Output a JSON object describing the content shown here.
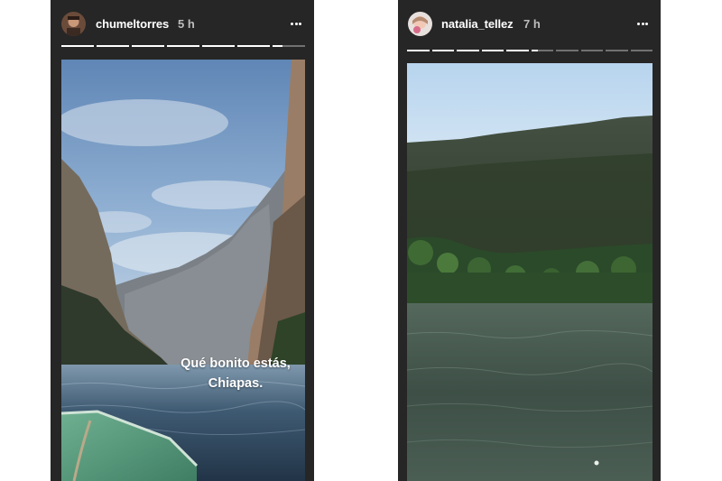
{
  "stories": [
    {
      "username": "chumeltorres",
      "time": "5 h",
      "more_icon": "more-horizontal-icon",
      "progress": {
        "segments": 7,
        "completed": 6,
        "current_fill": 0.3
      },
      "caption_lines": [
        "Qué bonito estás,",
        "Chiapas."
      ]
    },
    {
      "username": "natalia_tellez",
      "time": "7 h",
      "more_icon": "more-horizontal-icon",
      "progress": {
        "segments": 10,
        "completed": 5,
        "current_fill": 0.3
      }
    }
  ],
  "colors": {
    "panel": "#262626",
    "text": "#ffffff",
    "muted": "#bdbdbd"
  }
}
